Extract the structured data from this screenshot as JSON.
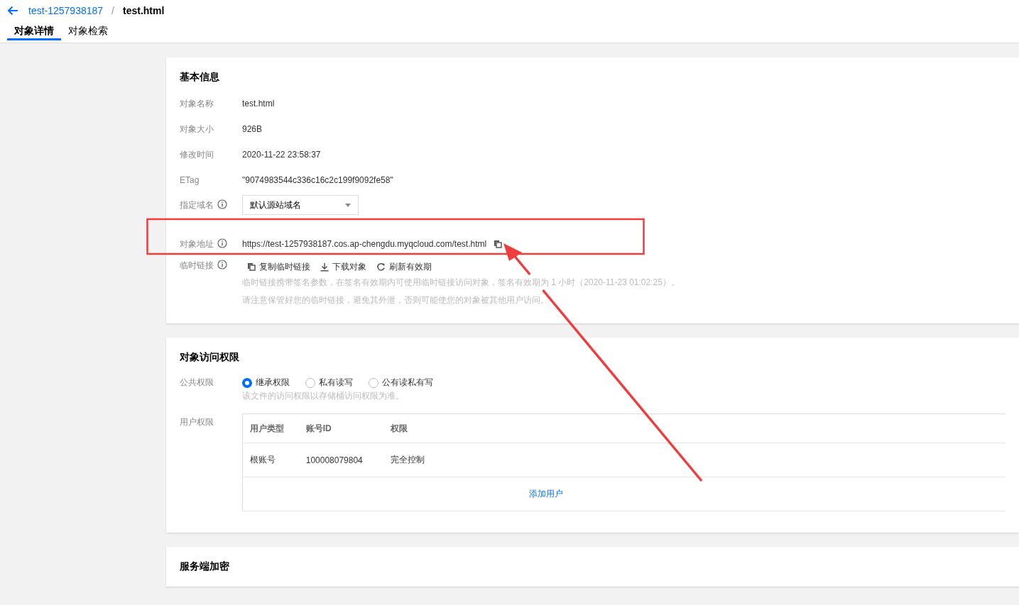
{
  "breadcrumb": {
    "parent": "test-1257938187",
    "separator": "/",
    "current": "test.html"
  },
  "tabs": [
    {
      "label": "对象详情",
      "selected": true
    },
    {
      "label": "对象检索",
      "selected": false
    }
  ],
  "basic_info": {
    "title": "基本信息",
    "fields": [
      {
        "kind": "text",
        "label": "对象名称",
        "info": false,
        "value": "test.html"
      },
      {
        "kind": "text",
        "label": "对象大小",
        "info": false,
        "value": "926B"
      },
      {
        "kind": "text",
        "label": "修改时间",
        "info": false,
        "value": "2020-11-22 23:58:37"
      },
      {
        "kind": "text",
        "label": "ETag",
        "info": false,
        "value": "\"9074983544c336c16c2c199f9092fe58\""
      },
      {
        "kind": "select",
        "label": "指定域名",
        "info": true,
        "value": "默认源站域名"
      },
      {
        "kind": "url",
        "label": "对象地址",
        "info": true,
        "value": "https://test-1257938187.cos.ap-chengdu.myqcloud.com/test.html"
      },
      {
        "kind": "actions",
        "label": "临时链接",
        "info": true,
        "actions": [
          {
            "kind": "copy",
            "label": "复制临时链接"
          },
          {
            "kind": "download",
            "label": "下载对象"
          },
          {
            "kind": "refresh",
            "label": "刷新有效期"
          }
        ],
        "hints": [
          "临时链接携带签名参数，在签名有效期内可使用临时链接访问对象，签名有效期为 1 小时（2020-11-23 01:02:25）。",
          "请注意保管好您的临时链接，避免其外泄，否则可能使您的对象被其他用户访问。"
        ]
      }
    ]
  },
  "permissions": {
    "title": "对象访问权限",
    "public": {
      "label": "公共权限",
      "options": [
        {
          "label": "继承权限",
          "selected": true
        },
        {
          "label": "私有读写",
          "selected": false
        },
        {
          "label": "公有读私有写",
          "selected": false
        }
      ],
      "hint": "该文件的访问权限以存储桶访问权限为准。"
    },
    "user": {
      "label": "用户权限",
      "columns": [
        "用户类型",
        "账号ID",
        "权限"
      ],
      "rows": [
        [
          "根账号",
          "100008079804",
          "完全控制"
        ]
      ],
      "add_link": "添加用户"
    }
  },
  "encryption": {
    "title": "服务端加密"
  },
  "annotation": {
    "kind": "box_with_arrow"
  }
}
